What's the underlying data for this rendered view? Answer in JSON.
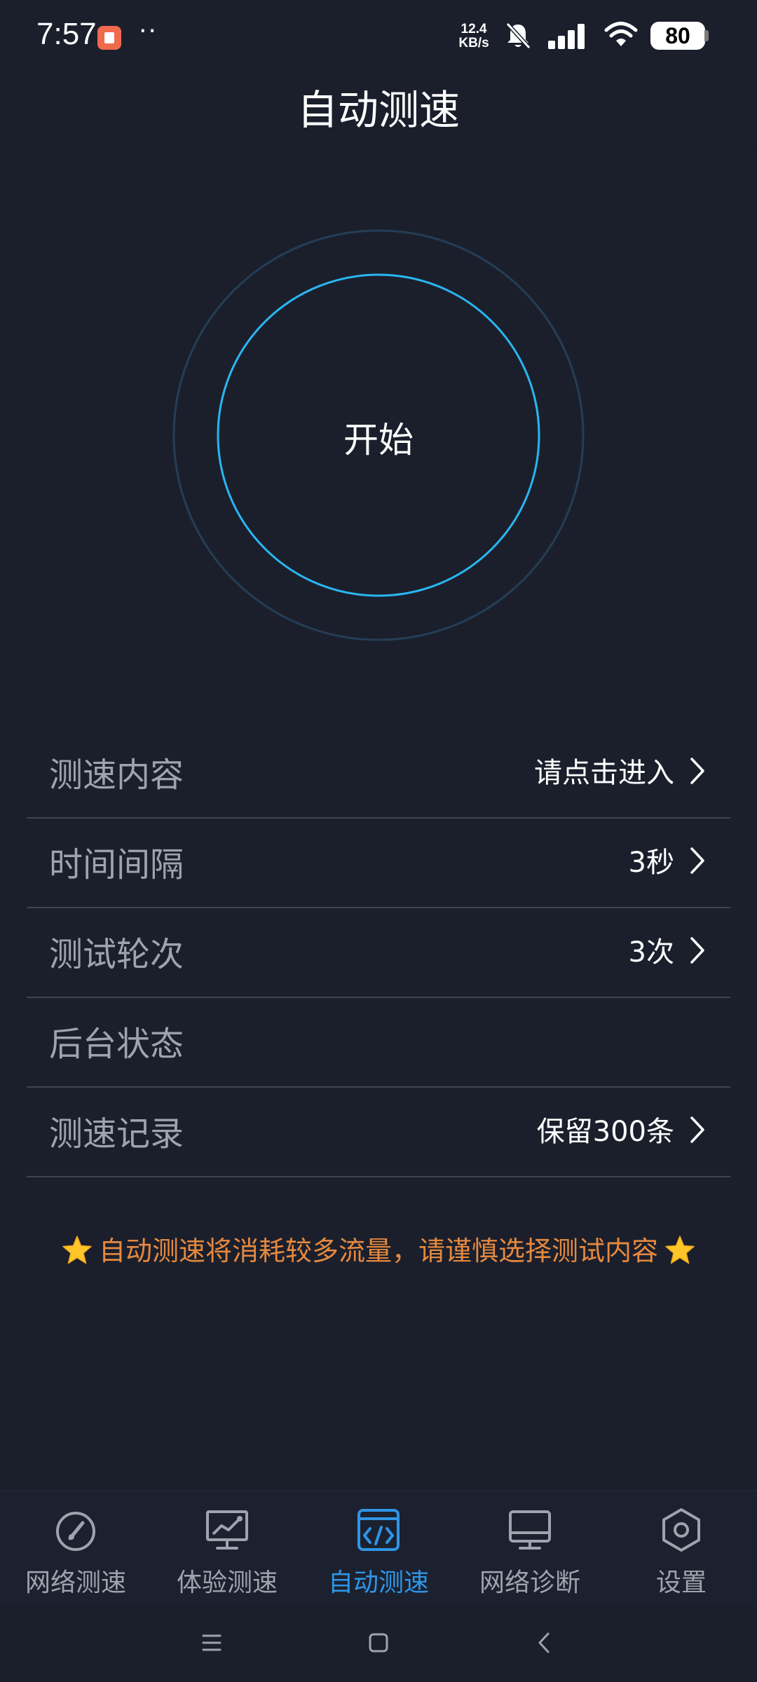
{
  "status_bar": {
    "time": "7:57",
    "dots": "··",
    "net_speed_value": "12.4",
    "net_speed_unit": "KB/s",
    "battery": "80"
  },
  "header": {
    "title": "自动测速"
  },
  "start_button": {
    "label": "开始"
  },
  "settings": [
    {
      "label": "测速内容",
      "value": "请点击进入",
      "has_chevron": true
    },
    {
      "label": "时间间隔",
      "value": "3秒",
      "has_chevron": true
    },
    {
      "label": "测试轮次",
      "value": "3次",
      "has_chevron": true
    },
    {
      "label": "后台状态",
      "value": "",
      "has_chevron": false
    },
    {
      "label": "测速记录",
      "value": "保留300条",
      "has_chevron": true
    }
  ],
  "warning": {
    "text": "自动测速将消耗较多流量，请谨慎选择测试内容"
  },
  "bottom_nav": [
    {
      "label": "网络测速",
      "icon": "speedometer-icon",
      "active": false
    },
    {
      "label": "体验测速",
      "icon": "monitor-chart-icon",
      "active": false
    },
    {
      "label": "自动测速",
      "icon": "code-window-icon",
      "active": true
    },
    {
      "label": "网络诊断",
      "icon": "desktop-icon",
      "active": false
    },
    {
      "label": "设置",
      "icon": "hexagon-gear-icon",
      "active": false
    }
  ],
  "colors": {
    "background": "#1b1f2c",
    "accent": "#2f95e6",
    "ring": "#29b6f0",
    "warning": "#e5893f",
    "muted_text": "#9ea3ad"
  }
}
